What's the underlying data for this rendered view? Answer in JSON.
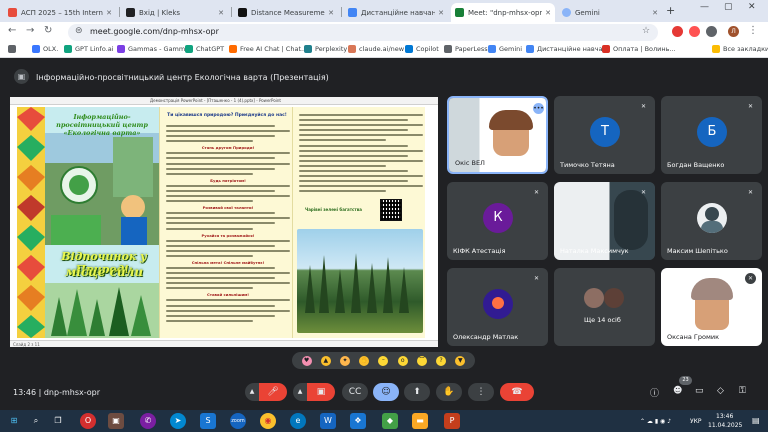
{
  "browser": {
    "tabs": [
      {
        "title": "АСП 2025 – 15th Internation",
        "color": "#e74c3c"
      },
      {
        "title": "Вхід | Kleks",
        "color": "#202124"
      },
      {
        "title": "Distance Measurement using",
        "color": "#111111"
      },
      {
        "title": "Дистанційне навчання з",
        "color": "#4285f4"
      },
      {
        "title": "Meet: \"dnp-mhsx-opr\"",
        "color": "#188038"
      },
      {
        "title": "Gemini",
        "color": "#8ab4f8"
      }
    ],
    "url": "meet.google.com/dnp-mhsx-opr",
    "profile_initial": "Л"
  },
  "bookmarks": [
    {
      "label": "OLX.",
      "color": "#3a77ff"
    },
    {
      "label": "GPT Linfo.ai",
      "color": "#10a37f"
    },
    {
      "label": "Gammas - Gamma",
      "color": "#7b3fe4"
    },
    {
      "label": "ChatGPT",
      "color": "#10a37f"
    },
    {
      "label": "Free AI Chat | Chat...",
      "color": "#ff6b00"
    },
    {
      "label": "Perplexity",
      "color": "#20808d"
    },
    {
      "label": "claude.ai/new",
      "color": "#d97757"
    },
    {
      "label": "Copilot",
      "color": "#0078d4"
    },
    {
      "label": "PaperLess",
      "color": "#5f6368"
    },
    {
      "label": "Gemini",
      "color": "#4285f4"
    },
    {
      "label": "Дистанційне навча...",
      "color": "#4285f4"
    },
    {
      "label": "Оплата | Волинь...",
      "color": "#d93025"
    },
    {
      "label": "Все закладки",
      "color": "#fbbc04"
    }
  ],
  "meeting": {
    "title": "Інформаційно-просвітницький центр Екологічна варта (Презентація)",
    "time": "13:46",
    "code": "dnp-mhsx-opr",
    "participants_badge": "23"
  },
  "presentation": {
    "window_title": "Демонстрація PowerPoint - [Пташенко - 1 (4).pptx] - PowerPoint",
    "status": "Слайд 2 з 11",
    "left_heading": "Інформаційно-просвітницький центр «Екологічна варта»",
    "big_title_line1": "Відпочинок у Природі:",
    "big_title_line2": "місце сили",
    "mid_heading": "Ти цікавишся природою? Приєднуйся до нас!",
    "qr_caption": "Чарівні зелені багатства",
    "sub_heads": [
      "Стань другом Природи!",
      "Будь патріотом!",
      "Розвивай свої таланти!",
      "Рухайся та розважайся!",
      "Спільна мета! Спільне майбутнє!",
      "Ставай сильнішим!"
    ]
  },
  "tiles": [
    {
      "name": "Окіс ВЕЛ",
      "type": "video"
    },
    {
      "name": "Тимочко Тетяна",
      "initial": "Т",
      "color": "#1565c0"
    },
    {
      "name": "Богдан Ващенко",
      "initial": "Б",
      "color": "#1565c0"
    },
    {
      "name": "КІФК Атестація",
      "initial": "К",
      "color": "#6a1b9a"
    },
    {
      "name": "Наталка Максимчук",
      "type": "video"
    },
    {
      "name": "Максим Шепітько",
      "type": "photo"
    },
    {
      "name": "Олександр Матлак",
      "type": "photo"
    },
    {
      "name": "Ще 14 осіб",
      "type": "group"
    },
    {
      "name": "Оксана Громик",
      "type": "video"
    }
  ],
  "reactions": [
    {
      "icon": "heart",
      "glyph": "♥",
      "color": "#f48fb1"
    },
    {
      "icon": "thumbs-up",
      "glyph": "👍",
      "color": "#fbc02d"
    },
    {
      "icon": "party",
      "glyph": "🎉",
      "color": "#ffb74d"
    },
    {
      "icon": "clap",
      "glyph": "👏",
      "color": "#fbc02d"
    },
    {
      "icon": "laugh",
      "glyph": "😂",
      "color": "#fdd835"
    },
    {
      "icon": "surprised",
      "glyph": "😮",
      "color": "#fdd835"
    },
    {
      "icon": "sad",
      "glyph": "😢",
      "color": "#fdd835"
    },
    {
      "icon": "thinking",
      "glyph": "🤔",
      "color": "#fdd835"
    },
    {
      "icon": "thumbs-down",
      "glyph": "👎",
      "color": "#fbc02d"
    }
  ],
  "taskbar": {
    "lang": "УКР",
    "clock": "13:46",
    "date": "11.04.2025"
  }
}
